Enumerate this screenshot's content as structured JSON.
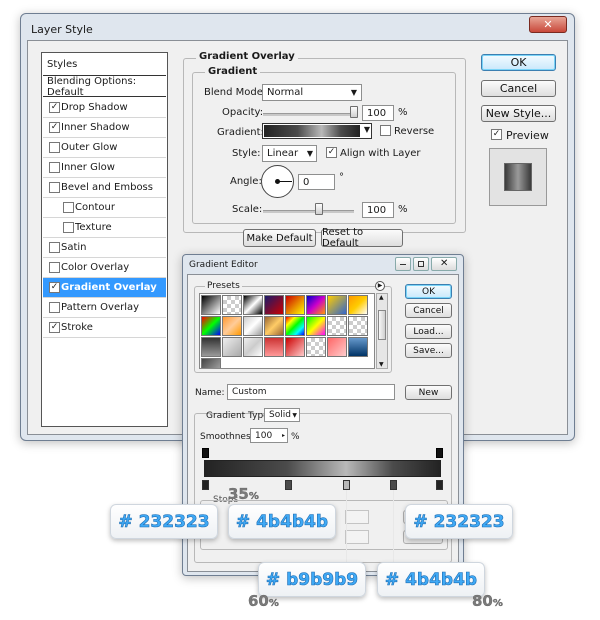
{
  "layer_style": {
    "title": "Layer Style",
    "sidebar": {
      "header": "Styles",
      "blending": "Blending Options: Default",
      "items": [
        {
          "label": "Drop Shadow",
          "checked": "✓"
        },
        {
          "label": "Inner Shadow",
          "checked": "✓"
        },
        {
          "label": "Outer Glow",
          "checked": ""
        },
        {
          "label": "Inner Glow",
          "checked": ""
        },
        {
          "label": "Bevel and Emboss",
          "checked": ""
        },
        {
          "label": "Contour",
          "checked": ""
        },
        {
          "label": "Texture",
          "checked": ""
        },
        {
          "label": "Satin",
          "checked": ""
        },
        {
          "label": "Color Overlay",
          "checked": ""
        },
        {
          "label": "Gradient Overlay",
          "checked": "✓"
        },
        {
          "label": "Pattern Overlay",
          "checked": ""
        },
        {
          "label": "Stroke",
          "checked": "✓"
        }
      ]
    },
    "section_title": "Gradient Overlay",
    "group_title": "Gradient",
    "blend_mode_label": "Blend Mode:",
    "blend_mode_value": "Normal",
    "opacity_label": "Opacity:",
    "opacity_value": "100",
    "opacity_unit": "%",
    "opacity_level": 1.0,
    "gradient_label": "Gradient:",
    "reverse_label": "Reverse",
    "style_label": "Style:",
    "style_value": "Linear",
    "align_label": "Align with Layer",
    "align_check": "✓",
    "angle_label": "Angle:",
    "angle_value": "0",
    "angle_unit": "°",
    "scale_label": "Scale:",
    "scale_value": "100",
    "scale_unit": "%",
    "scale_level": 0.5,
    "make_default": "Make Default",
    "reset_default": "Reset to Default",
    "ok": "OK",
    "cancel": "Cancel",
    "new_style": "New Style...",
    "preview_label": "Preview",
    "preview_check": "✓"
  },
  "gradient_editor": {
    "title": "Gradient Editor",
    "presets_label": "Presets",
    "ok": "OK",
    "cancel": "Cancel",
    "load": "Load...",
    "save": "Save...",
    "name_label": "Name:",
    "name_value": "Custom",
    "new_button": "New",
    "type_label": "Gradient Type:",
    "type_value": "Solid",
    "smooth_label": "Smoothness:",
    "smooth_value": "100",
    "smooth_unit": "%",
    "stops_label": "Stops"
  },
  "color_stops": [
    {
      "color": "#232323",
      "location": 0
    },
    {
      "color": "#4b4b4b",
      "location": 35
    },
    {
      "color": "#b9b9b9",
      "location": 60
    },
    {
      "color": "#4b4b4b",
      "location": 80
    },
    {
      "color": "#232323",
      "location": 100
    }
  ],
  "callouts": {
    "c1": "# 232323",
    "c2": "# 4b4b4b",
    "c3": "# 232323",
    "c4": "# b9b9b9",
    "c5": "# 4b4b4b"
  },
  "percents": {
    "p35": "35",
    "p60": "60",
    "p80": "80",
    "unit": "%"
  },
  "colors": {
    "selection": "#3399ff",
    "close_button": "#c9483a",
    "callout_text": "#3fa9f5"
  }
}
